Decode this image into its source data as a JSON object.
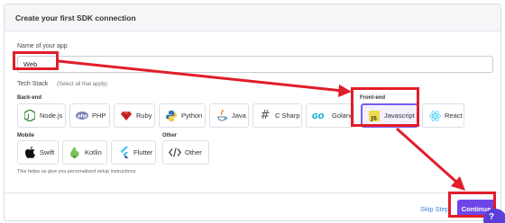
{
  "header": {
    "title": "Create your first SDK connection"
  },
  "app_name": {
    "label": "Name of your app",
    "value": "Web"
  },
  "tech_stack": {
    "label": "Tech Stack",
    "hint": "(Select all that apply)",
    "backend_label": "Back-end",
    "frontend_label": "Front-end",
    "mobile_label": "Mobile",
    "other_label": "Other",
    "backend": [
      {
        "name": "Node.js",
        "icon": "nodejs-icon"
      },
      {
        "name": "PHP",
        "icon": "php-icon"
      },
      {
        "name": "Ruby",
        "icon": "ruby-icon"
      },
      {
        "name": "Python",
        "icon": "python-icon"
      },
      {
        "name": "Java",
        "icon": "java-icon"
      },
      {
        "name": "C Sharp",
        "icon": "csharp-icon"
      },
      {
        "name": "Golang",
        "icon": "golang-icon"
      }
    ],
    "frontend": [
      {
        "name": "Javascript",
        "icon": "javascript-icon",
        "selected": true
      },
      {
        "name": "React",
        "icon": "react-icon"
      }
    ],
    "mobile": [
      {
        "name": "Swift",
        "icon": "swift-icon"
      },
      {
        "name": "Kotlin",
        "icon": "kotlin-icon"
      },
      {
        "name": "Flutter",
        "icon": "flutter-icon"
      }
    ],
    "other": [
      {
        "name": "Other",
        "icon": "code-icon"
      }
    ]
  },
  "footer_hint": "This helps us give you personalized setup instructions",
  "actions": {
    "skip": "Skip Step",
    "continue": "Continue"
  },
  "colors": {
    "accent": "#6d46e8",
    "annotation": "#e11d2a",
    "link": "#3b82d6"
  }
}
